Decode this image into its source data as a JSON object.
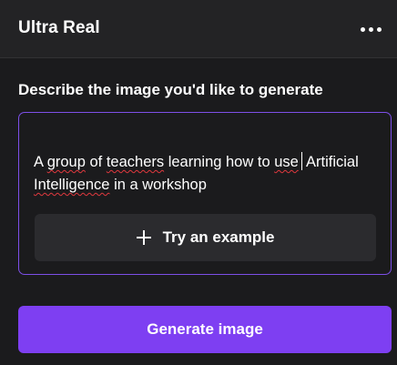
{
  "header": {
    "title": "Ultra Real",
    "more_icon": "more-horizontal-icon"
  },
  "prompt": {
    "label": "Describe the image you'd like to generate",
    "words": [
      "A ",
      "group",
      " of ",
      "teachers",
      " learning how to ",
      "use",
      " Artificial ",
      "Intelligence",
      " in a workshop"
    ],
    "try_example_label": "Try an example",
    "try_example_icon": "plus-icon"
  },
  "actions": {
    "generate_label": "Generate image"
  },
  "colors": {
    "accent": "#7e3ff2",
    "focus_border": "#7d4fe8",
    "background": "#1b1b1d",
    "header_background": "#232325",
    "spellcheck_underline": "#e0383e"
  }
}
